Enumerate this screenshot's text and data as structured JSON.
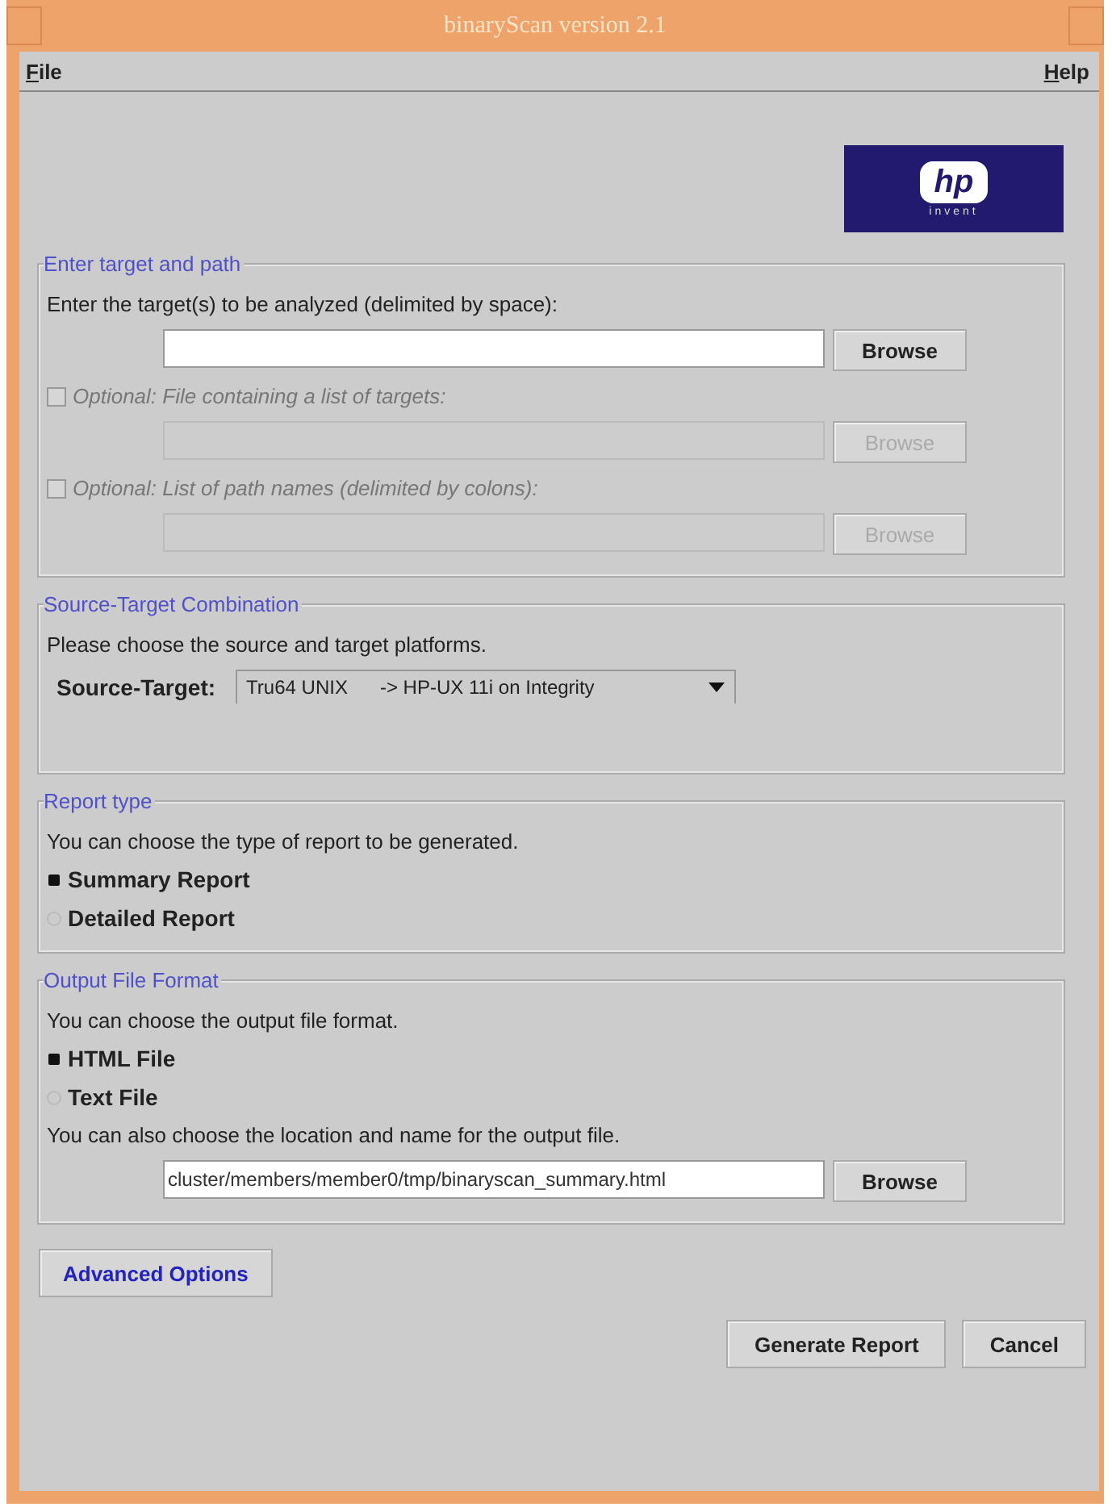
{
  "window": {
    "title": "binaryScan version 2.1"
  },
  "menu": [
    "File",
    "Help"
  ],
  "logo": {
    "mark": "hp",
    "tagline": "invent"
  },
  "sections": [
    {
      "title": "Enter target and path",
      "items": [
        {
          "kind": "text",
          "text": "Enter the target(s) to be analyzed (delimited by space):"
        },
        {
          "kind": "field",
          "value": "",
          "button": "Browse",
          "disabled": false
        },
        {
          "kind": "checkbox",
          "label": "Optional: File containing a list of targets:",
          "checked": false
        },
        {
          "kind": "field",
          "value": "",
          "button": "Browse",
          "disabled": true
        },
        {
          "kind": "checkbox",
          "label": "Optional: List of path names (delimited by colons):",
          "checked": false
        },
        {
          "kind": "field",
          "value": "",
          "button": "Browse",
          "disabled": true
        }
      ]
    },
    {
      "title": "Source-Target Combination",
      "items": [
        {
          "kind": "text",
          "text": "Please choose the source and target platforms."
        },
        {
          "kind": "select",
          "label": "Source-Target:",
          "value": "Tru64 UNIX      -> HP-UX 11i on Integrity"
        }
      ]
    },
    {
      "title": "Report type",
      "items": [
        {
          "kind": "text",
          "text": "You can choose the type of report to be generated."
        },
        {
          "kind": "radio",
          "label": "Summary Report",
          "selected": true
        },
        {
          "kind": "radio",
          "label": "Detailed Report",
          "selected": false
        }
      ]
    },
    {
      "title": "Output File Format",
      "items": [
        {
          "kind": "text",
          "text": "You can choose the output file format."
        },
        {
          "kind": "radio",
          "label": "HTML File",
          "selected": true
        },
        {
          "kind": "radio",
          "label": "Text File",
          "selected": false
        },
        {
          "kind": "text",
          "text": "You can also choose the location and name for the output file."
        },
        {
          "kind": "field",
          "value": "cluster/members/member0/tmp/binaryscan_summary.html",
          "button": "Browse",
          "disabled": false
        }
      ]
    }
  ],
  "advanced_button": "Advanced Options",
  "buttons": [
    "Generate Report",
    "Cancel"
  ]
}
